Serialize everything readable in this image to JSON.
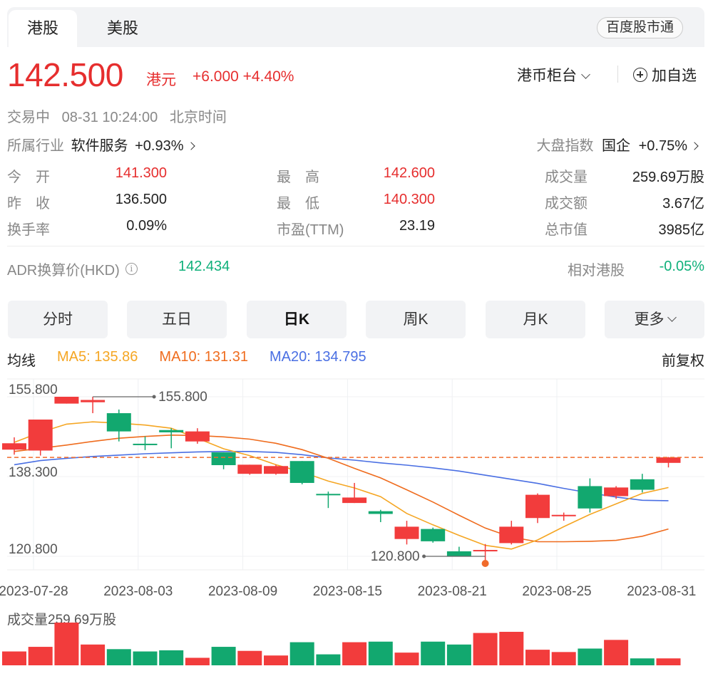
{
  "tabs": {
    "hk": "港股",
    "us": "美股",
    "link": "百度股市通"
  },
  "quote": {
    "price": "142.500",
    "unit": "港元",
    "change": "+6.000",
    "change_pct": "+4.40%",
    "counter": "港币柜台",
    "add_watch": "加自选",
    "status": "交易中",
    "datetime": "08-31 10:24:00",
    "timezone": "北京时间",
    "industry_label": "所属行业",
    "industry_name": "软件服务",
    "industry_change": "+0.93%",
    "index_label": "大盘指数",
    "index_name": "国企",
    "index_change": "+0.75%"
  },
  "stats": {
    "open_label": "今　开",
    "open": "141.300",
    "prev_label": "昨　收",
    "prev": "136.500",
    "turnover_rate_label": "换手率",
    "turnover_rate": "0.09%",
    "high_label": "最　高",
    "high": "142.600",
    "low_label": "最　低",
    "low": "140.300",
    "pe_label": "市盈(TTM)",
    "pe": "23.19",
    "volume_label": "成交量",
    "volume": "259.69万股",
    "amount_label": "成交额",
    "amount": "3.67亿",
    "mktcap_label": "总市值",
    "mktcap": "3985亿"
  },
  "adr": {
    "label": "ADR换算价(HKD)",
    "info_icon": "i",
    "value": "142.434",
    "rel_label": "相对港股",
    "rel_value": "-0.05%"
  },
  "kline_tabs": [
    "分时",
    "五日",
    "日K",
    "周K",
    "月K",
    "更多"
  ],
  "ma": {
    "title": "均线",
    "ma5": "MA5: 135.86",
    "ma10": "MA10: 131.31",
    "ma20": "MA20: 134.795",
    "adjust": "前复权"
  },
  "volume_label": "成交量259.69万股",
  "colors": {
    "up": "#f23c3c",
    "down": "#12a86f",
    "ma5": "#f5a623",
    "ma10": "#ef6c1e",
    "ma20": "#4a6fe3"
  },
  "chart_data": {
    "type": "candlestick",
    "y_ticks": [
      "155.800",
      "138.300",
      "120.800"
    ],
    "ylim": [
      120.8,
      155.8
    ],
    "x_tick_labels": [
      "2023-07-28",
      "2023-08-03",
      "2023-08-09",
      "2023-08-15",
      "2023-08-21",
      "2023-08-25",
      "2023-08-31"
    ],
    "x_tick_index": [
      0,
      4,
      8,
      12,
      16,
      20,
      24
    ],
    "max_annotation": "155.800",
    "min_annotation": "120.800",
    "current_price": 142.5,
    "candles": [
      {
        "o": 144.2,
        "c": 145.6,
        "h": 146.9,
        "l": 143.1
      },
      {
        "o": 144.0,
        "c": 150.8,
        "h": 150.8,
        "l": 142.9
      },
      {
        "o": 154.3,
        "c": 155.8,
        "h": 155.8,
        "l": 154.3
      },
      {
        "o": 154.6,
        "c": 155.1,
        "h": 155.8,
        "l": 152.2
      },
      {
        "o": 152.2,
        "c": 148.2,
        "h": 153.0,
        "l": 146.0
      },
      {
        "o": 145.5,
        "c": 145.3,
        "h": 147.1,
        "l": 144.1
      },
      {
        "o": 148.5,
        "c": 148.0,
        "h": 148.9,
        "l": 144.5
      },
      {
        "o": 146.0,
        "c": 148.2,
        "h": 148.9,
        "l": 145.5
      },
      {
        "o": 143.6,
        "c": 140.8,
        "h": 143.6,
        "l": 139.9
      },
      {
        "o": 138.9,
        "c": 140.9,
        "h": 140.9,
        "l": 138.7
      },
      {
        "o": 138.9,
        "c": 140.6,
        "h": 140.9,
        "l": 138.7
      },
      {
        "o": 141.7,
        "c": 136.9,
        "h": 141.7,
        "l": 136.6
      },
      {
        "o": 134.5,
        "c": 134.3,
        "h": 135.0,
        "l": 131.4
      },
      {
        "o": 132.5,
        "c": 133.7,
        "h": 136.9,
        "l": 132.5
      },
      {
        "o": 130.7,
        "c": 130.1,
        "h": 131.0,
        "l": 128.3
      },
      {
        "o": 124.6,
        "c": 127.3,
        "h": 128.6,
        "l": 123.4
      },
      {
        "o": 126.8,
        "c": 124.1,
        "h": 127.1,
        "l": 123.8
      },
      {
        "o": 121.9,
        "c": 120.8,
        "h": 122.9,
        "l": 120.8
      },
      {
        "o": 121.9,
        "c": 122.2,
        "h": 123.5,
        "l": 119.7
      },
      {
        "o": 123.7,
        "c": 127.3,
        "h": 128.6,
        "l": 123.4
      },
      {
        "o": 129.2,
        "c": 134.3,
        "h": 134.6,
        "l": 128.1
      },
      {
        "o": 129.9,
        "c": 129.9,
        "h": 130.4,
        "l": 128.6
      },
      {
        "o": 136.2,
        "c": 131.3,
        "h": 137.9,
        "l": 130.4
      },
      {
        "o": 134.0,
        "c": 135.9,
        "h": 136.2,
        "l": 133.4
      },
      {
        "o": 137.7,
        "c": 135.4,
        "h": 138.9,
        "l": 134.8
      },
      {
        "o": 141.3,
        "c": 142.5,
        "h": 142.6,
        "l": 140.3
      }
    ],
    "ma5": [
      145.8,
      148.0,
      149.8,
      150.3,
      150.0,
      149.6,
      148.9,
      146.7,
      144.4,
      142.9,
      140.9,
      139.3,
      137.3,
      135.8,
      133.9,
      130.2,
      127.7,
      125.4,
      123.2,
      122.4,
      124.4,
      127.3,
      130.0,
      132.3,
      134.6,
      135.9
    ],
    "ma10": [
      143.8,
      144.5,
      145.2,
      146.0,
      146.7,
      147.1,
      147.4,
      147.3,
      147.0,
      146.5,
      145.6,
      144.2,
      142.3,
      140.1,
      138.0,
      135.4,
      132.7,
      129.8,
      127.0,
      125.0,
      124.0,
      124.0,
      124.1,
      124.3,
      125.2,
      126.8
    ],
    "ma20": [
      140.9,
      141.8,
      142.3,
      142.7,
      143.0,
      143.3,
      143.5,
      143.7,
      143.8,
      143.8,
      143.6,
      143.1,
      142.4,
      141.9,
      141.3,
      140.8,
      140.2,
      139.5,
      138.6,
      137.7,
      136.8,
      135.7,
      134.7,
      133.8,
      133.1,
      133.0
    ],
    "volume": {
      "label": "成交量259.69万股",
      "values": [
        24,
        32,
        74,
        36,
        28,
        24,
        26,
        13,
        32,
        25,
        17,
        40,
        19,
        40,
        41,
        22,
        41,
        36,
        56,
        58,
        27,
        23,
        29,
        44,
        12,
        12
      ]
    }
  }
}
